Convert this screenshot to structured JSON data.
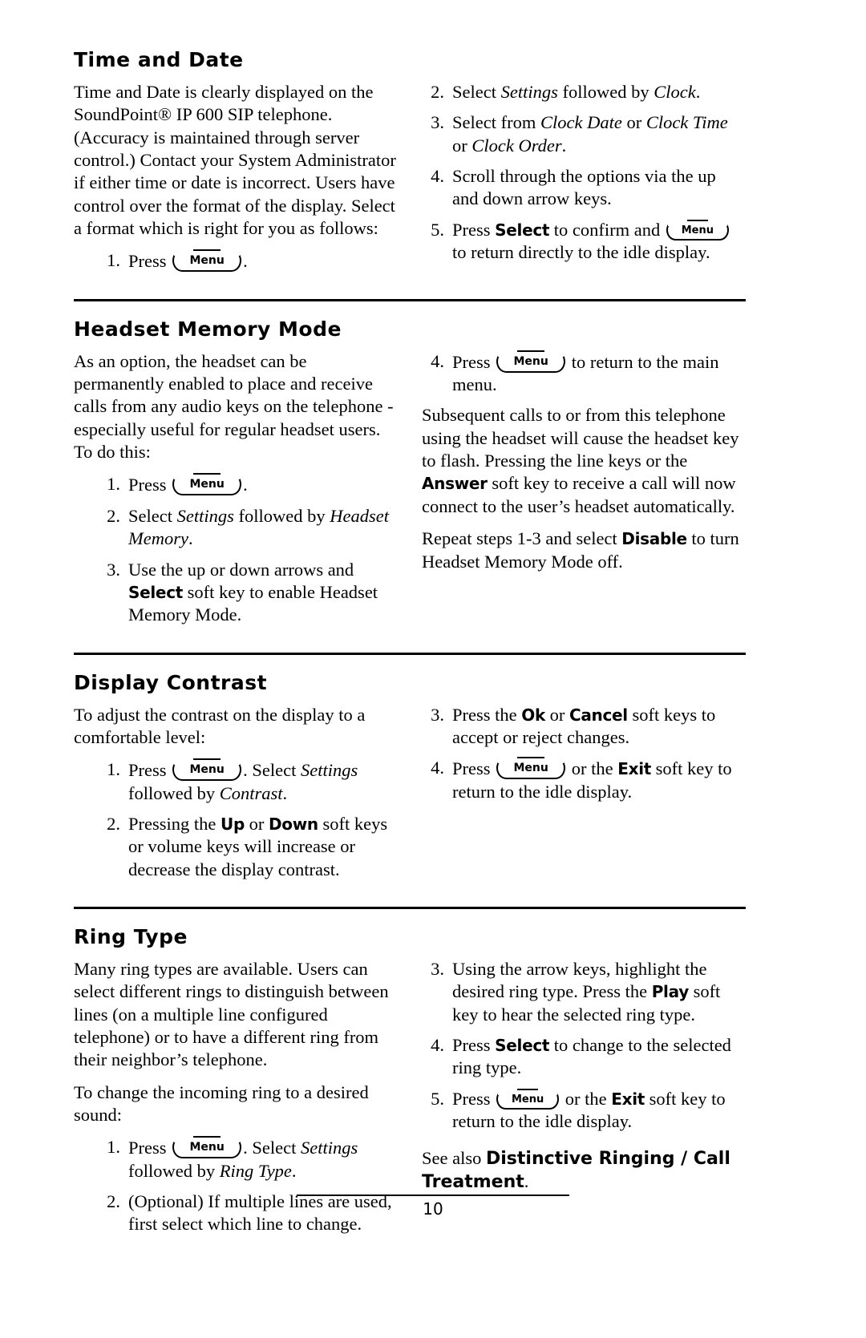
{
  "document": {
    "page_number": "10"
  },
  "sections": [
    {
      "id": "time-and-date",
      "title": "Time and Date",
      "left": {
        "intro": "Time and Date is clearly displayed on the SoundPoint® IP 600 SIP telephone.  (Accuracy is maintained through server control.)  Contact your System Administrator if either time or date is incorrect.  Users have control over the format of the display.  Select a format which is right for you as follows:",
        "steps": [
          {
            "num": "1.",
            "pre": "Press ",
            "key": "Menu",
            "post": "."
          }
        ]
      },
      "right": {
        "steps": [
          {
            "num": "2.",
            "text_parts": [
              "Select ",
              "Settings",
              " followed by ",
              "Clock",
              "."
            ]
          },
          {
            "num": "3.",
            "text_parts": [
              "Select from ",
              "Clock Date",
              " or ",
              "Clock Time",
              " or ",
              "Clock Order",
              "."
            ]
          },
          {
            "num": "4.",
            "text_parts": [
              "Scroll through the options via the up and down arrow keys."
            ]
          },
          {
            "num": "5.",
            "pre": "Press ",
            "softkey": "Select",
            "mid": " to confirm and ",
            "key": "Menu",
            "post": " to return directly to the idle display."
          }
        ]
      }
    },
    {
      "id": "headset-memory-mode",
      "title": "Headset Memory Mode",
      "left": {
        "intro": "As an option, the headset can be permanently enabled to place and receive calls from any audio keys on the telephone - especially useful for regular headset users.  To do this:",
        "steps": [
          {
            "num": "1.",
            "pre": "Press ",
            "key": "Menu",
            "post": "."
          },
          {
            "num": "2.",
            "text_parts": [
              "Select ",
              "Settings",
              " followed by ",
              "Headset Memory",
              "."
            ]
          },
          {
            "num": "3.",
            "pre": "Use the up or down arrows and ",
            "softkey": "Select",
            "post": " soft key to enable Headset Memory Mode."
          }
        ]
      },
      "right": {
        "steps": [
          {
            "num": "4.",
            "pre": "Press ",
            "key": "Menu",
            "post": " to return to the main menu."
          }
        ],
        "paragraphs": [
          "Subsequent calls to or from this telephone using the headset will cause the headset key to flash.  Pressing the line keys or the ",
          "Answer",
          " soft key to receive a call will now connect to the user’s headset automatically.",
          "Repeat steps 1-3 and select ",
          "Disable",
          " to turn Headset Memory Mode off."
        ]
      }
    },
    {
      "id": "display-contrast",
      "title": "Display Contrast",
      "left": {
        "intro": "To adjust the contrast on the display to a comfortable level:",
        "steps": [
          {
            "num": "1.",
            "pre": "Press ",
            "key": "Menu",
            "mid": ".  Select ",
            "italic": "Settings",
            "post": " followed by ",
            "italic2": "Contrast",
            "end": "."
          },
          {
            "num": "2.",
            "pre": "Pressing the ",
            "softkey": "Up",
            "mid": " or ",
            "softkey2": "Down",
            "post": " soft keys or volume keys will increase or decrease the display contrast."
          }
        ]
      },
      "right": {
        "steps": [
          {
            "num": "3.",
            "pre": "Press the ",
            "softkey": "Ok",
            "mid": " or ",
            "softkey2": "Cancel",
            "post": " soft keys to accept or reject changes."
          },
          {
            "num": "4.",
            "pre": "Press ",
            "key": "Menu",
            "mid": " or the ",
            "softkey": "Exit",
            "post": " soft key to return to the idle display."
          }
        ]
      }
    },
    {
      "id": "ring-type",
      "title": "Ring Type",
      "left": {
        "paragraphs": [
          "Many ring types are available.  Users can select different rings to distinguish between lines (on a multiple line configured telephone) or to have a different ring from their neighbor’s telephone.",
          "To change the incoming ring to a desired sound:"
        ],
        "steps": [
          {
            "num": "1.",
            "pre": "Press ",
            "key": "Menu",
            "mid": ".  Select ",
            "italic": "Settings",
            "post": " followed by ",
            "italic2": "Ring Type",
            "end": "."
          },
          {
            "num": "2.",
            "text_parts": [
              "(Optional)  If multiple lines are used, first select which line to change."
            ]
          }
        ]
      },
      "right": {
        "steps": [
          {
            "num": "3.",
            "pre": "Using the arrow keys, highlight the desired ring type.  Press the ",
            "softkey": "Play",
            "post": " soft key to hear the selected ring type."
          },
          {
            "num": "4.",
            "pre": "Press ",
            "softkey": "Select",
            "post": " to change to the selected ring type."
          },
          {
            "num": "5.",
            "pre": "Press ",
            "key": "Menu",
            "mid": " or the ",
            "softkey": "Exit",
            "post": " soft key to return to the idle display."
          }
        ],
        "see_also": {
          "prefix": "See also ",
          "bold": "Distinctive Ringing / Call Treatment",
          "suffix": "."
        }
      }
    }
  ]
}
